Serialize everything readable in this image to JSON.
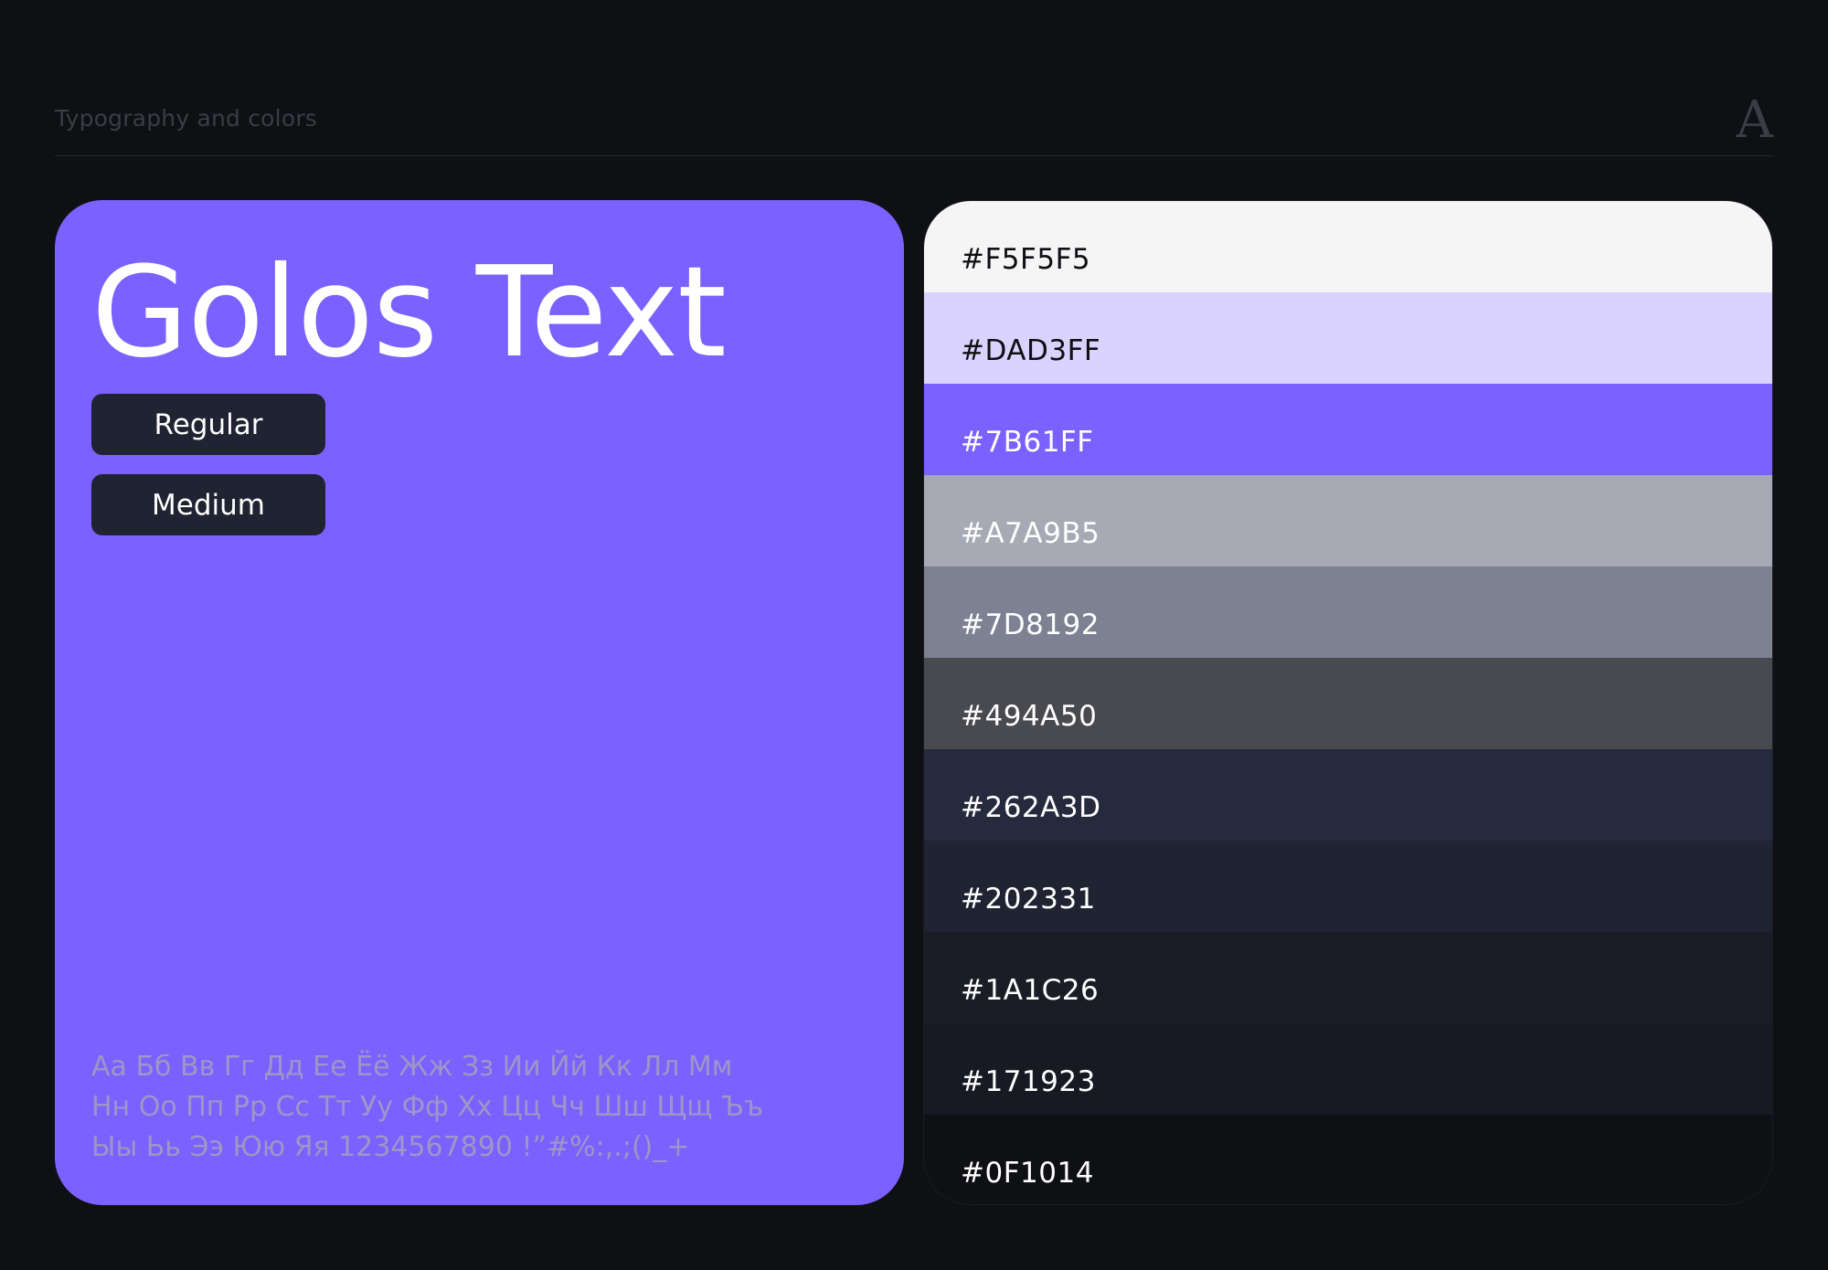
{
  "header": {
    "title": "Typography and colors",
    "logo_glyph": "A"
  },
  "type_card": {
    "font_name": "Golos Text",
    "background": "#7B61FF",
    "weights": [
      "Regular",
      "Medium"
    ],
    "specimen_lines": [
      "Аа Бб Вв Гг Дд Ее Ёё Жж Зз Ии Йй Кк Лл Мм",
      "Нн Оо Пп Рр Сс Тт Уу Фф Хх Цц Чч Шш Щщ Ъъ",
      "Ыы Ьь Ээ Юю Яя 1234567890 !”#%:,.;()_+"
    ]
  },
  "palette": [
    {
      "label": "#F5F5F5",
      "color": "#F5F5F5",
      "text_color": "#0F1014"
    },
    {
      "label": "#DAD3FF",
      "color": "#DAD3FF",
      "text_color": "#0F1014"
    },
    {
      "label": "#7B61FF",
      "color": "#7B61FF",
      "text_color": "#FFFFFF"
    },
    {
      "label": "#A7A9B5",
      "color": "#A7A9B5",
      "text_color": "#FFFFFF"
    },
    {
      "label": "#7D8192",
      "color": "#7D8192",
      "text_color": "#FFFFFF"
    },
    {
      "label": "#494A50",
      "color": "#494A50",
      "text_color": "#FFFFFF"
    },
    {
      "label": "#262A3D",
      "color": "#262A3D",
      "text_color": "#FFFFFF"
    },
    {
      "label": "#202331",
      "color": "#202331",
      "text_color": "#FFFFFF"
    },
    {
      "label": "#1A1C26",
      "color": "#1A1C26",
      "text_color": "#FFFFFF"
    },
    {
      "label": "#171923",
      "color": "#171923",
      "text_color": "#FFFFFF"
    },
    {
      "label": "#0F1014",
      "color": "#0F1014",
      "text_color": "#FFFFFF"
    }
  ]
}
